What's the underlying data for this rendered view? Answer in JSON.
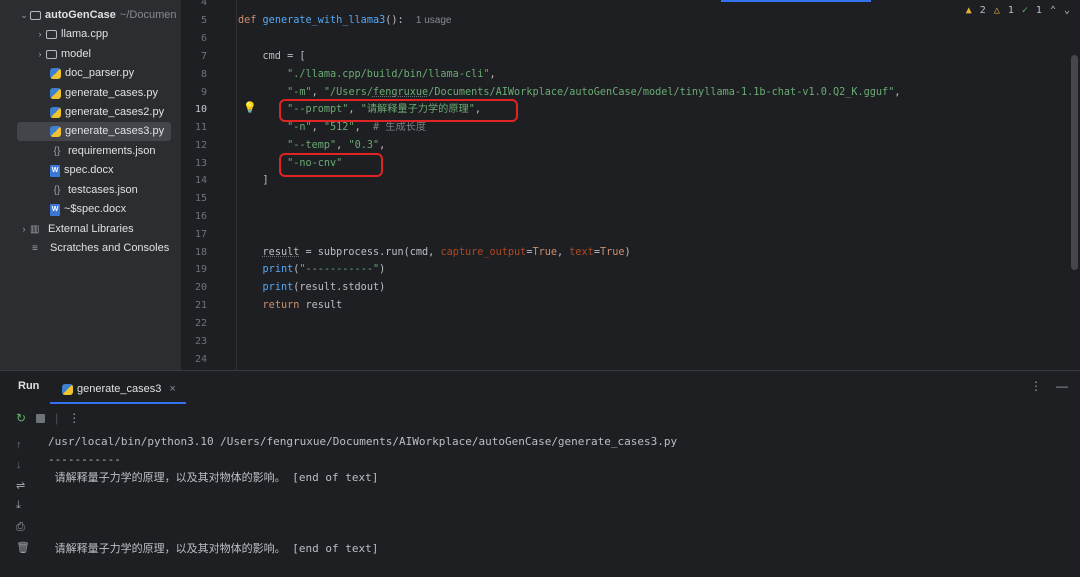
{
  "project_tree": {
    "root_name": "autoGenCase",
    "root_path": "~/Documen",
    "items": [
      {
        "label": "llama.cpp",
        "type": "folder",
        "icon": "folder-icon"
      },
      {
        "label": "model",
        "type": "folder",
        "icon": "folder-icon"
      },
      {
        "label": "doc_parser.py",
        "type": "python",
        "icon": "python-file-icon"
      },
      {
        "label": "generate_cases.py",
        "type": "python",
        "icon": "python-file-icon"
      },
      {
        "label": "generate_cases2.py",
        "type": "python",
        "icon": "python-file-icon"
      },
      {
        "label": "generate_cases3.py",
        "type": "python",
        "icon": "python-file-icon",
        "selected": true
      },
      {
        "label": "requirements.json",
        "type": "json",
        "icon": "json-file-icon"
      },
      {
        "label": "spec.docx",
        "type": "docx",
        "icon": "docx-file-icon"
      },
      {
        "label": "testcases.json",
        "type": "json",
        "icon": "json-file-icon"
      },
      {
        "label": "~$spec.docx",
        "type": "docx",
        "icon": "docx-file-icon"
      }
    ],
    "external_libraries": "External Libraries",
    "scratches": "Scratches and Consoles"
  },
  "editor": {
    "inspections": {
      "warnings_a": "2",
      "warnings_b": "1",
      "ok": "1"
    },
    "usage_hint": "1 usage",
    "line_numbers": [
      "4",
      "5",
      "6",
      "7",
      "8",
      "9",
      "10",
      "11",
      "12",
      "13",
      "14",
      "15",
      "16",
      "17",
      "18",
      "19",
      "20",
      "21",
      "22",
      "23",
      "24"
    ],
    "current_line": "10",
    "code": {
      "l5_def": "def ",
      "l5_fn": "generate_with_llama3",
      "l5_rest": "():",
      "l7": "    cmd = [",
      "l8_str": "\"./llama.cpp/build/bin/llama-cli\"",
      "l9_a": "\"-m\"",
      "l9_b": "\"/Users/",
      "l9_c": "fengruxue",
      "l9_d": "/Documents/AIWorkplace/autoGenCase/model/tinyllama-1.1b-chat-v1.0.Q2_K.gguf\"",
      "l10_a": "\"--prompt\"",
      "l10_b": "\"请解释量子力学的原理\"",
      "l11_a": "\"-n\"",
      "l11_b": "\"512\"",
      "l11_c": "# 生成长度",
      "l12_a": "\"--temp\"",
      "l12_b": "\"0.3\"",
      "l13": "\"-no-cnv\"",
      "l14": "    ]",
      "l18_a": "result",
      "l18_b": " = subprocess.run(cmd, ",
      "l18_c": "capture_output",
      "l18_d": "True",
      "l18_e": "text",
      "l18_f": "True",
      "l19_a": "print",
      "l19_b": "\"-----------\"",
      "l20_a": "print",
      "l20_b": "(result.stdout)",
      "l21_a": "return",
      "l21_b": " result"
    }
  },
  "run_panel": {
    "title": "Run",
    "tab_label": "generate_cases3",
    "console_lines": [
      "/usr/local/bin/python3.10 /Users/fengruxue/Documents/AIWorkplace/autoGenCase/generate_cases3.py",
      "-----------",
      " 请解释量子力学的原理，以及其对物体的影响。 [end of text]",
      "",
      "",
      "",
      " 请解释量子力学的原理，以及其对物体的影响。 [end of text]"
    ]
  },
  "colors": {
    "accent": "#3574f0",
    "annotation_box": "#e02424",
    "string": "#6aab73",
    "keyword": "#cf8e6d",
    "function": "#56a8f5"
  }
}
